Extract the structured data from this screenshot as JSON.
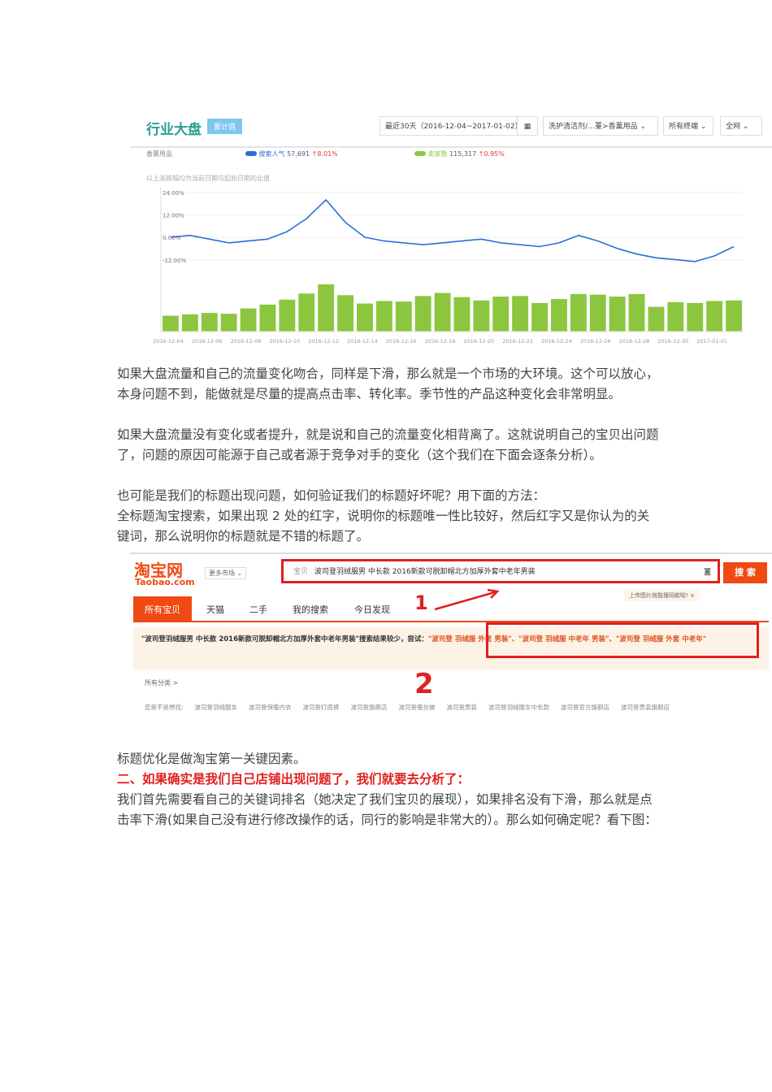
{
  "dashboard": {
    "title": "行业大盘",
    "badge": "累计值",
    "date_range": "最近30天（2016-12-04~2017-01-02）",
    "calendar_icon": "calendar-icon",
    "category": "洗护清洁剂/…薹>香薰用品",
    "terminal": "所有终端",
    "region": "全网",
    "category_label": "香薰用品",
    "note": "以上涨跌幅均为当前日期与起始日期的比值"
  },
  "chart_data": {
    "type": "bar+line",
    "title": "行业大盘",
    "x": [
      "2016-12-04",
      "2016-12-05",
      "2016-12-06",
      "2016-12-07",
      "2016-12-08",
      "2016-12-09",
      "2016-12-10",
      "2016-12-11",
      "2016-12-12",
      "2016-12-13",
      "2016-12-14",
      "2016-12-15",
      "2016-12-16",
      "2016-12-17",
      "2016-12-18",
      "2016-12-19",
      "2016-12-20",
      "2016-12-21",
      "2016-12-22",
      "2016-12-23",
      "2016-12-24",
      "2016-12-25",
      "2016-12-26",
      "2016-12-27",
      "2016-12-28",
      "2016-12-29",
      "2016-12-30",
      "2016-12-31",
      "2017-01-01",
      "2017-01-02"
    ],
    "tick_labels": [
      "2016-12-04",
      "2016-12-06",
      "2016-12-08",
      "2016-12-10",
      "2016-12-12",
      "2016-12-14",
      "2016-12-16",
      "2016-12-18",
      "2016-12-20",
      "2016-12-22",
      "2016-12-24",
      "2016-12-26",
      "2016-12-28",
      "2016-12-30",
      "2017-01-01"
    ],
    "yticks": [
      "24.00%",
      "12.00%",
      "0.00%",
      "-12.00%"
    ],
    "ylim": [
      -18,
      24
    ],
    "series": [
      {
        "name": "搜索人气",
        "value": "57,691",
        "change": "8.01%",
        "color": "#2b6fd6",
        "type": "line",
        "values": [
          0,
          1,
          -1,
          -3,
          -2,
          -1,
          3,
          10,
          20,
          8,
          0,
          -2,
          -3,
          -4,
          -3,
          -2,
          -1,
          -3,
          -4,
          -5,
          -3,
          1,
          -2,
          -6,
          -9,
          -11,
          -12,
          -13,
          -10,
          -5
        ]
      },
      {
        "name": "卖家数",
        "value": "115,317",
        "change": "0.95%",
        "color": "#8cc63f",
        "type": "bar",
        "values": [
          57,
          62,
          67,
          64,
          83,
          97,
          115,
          137,
          170,
          131,
          101,
          110,
          108,
          128,
          139,
          124,
          112,
          126,
          128,
          103,
          117,
          135,
          133,
          126,
          135,
          89,
          106,
          103,
          110,
          112
        ]
      }
    ]
  },
  "paragraphs": [
    "如果大盘流量和自己的流量变化吻合，同样是下滑，那么就是一个市场的大环境。这个可以放心，本身问题不到，能做就是尽量的提高点击率、转化率。季节性的产品这种变化会非常明显。",
    "如果大盘流量没有变化或者提升，就是说和自己的流量变化相背离了。这就说明自己的宝贝出问题了，问题的原因可能源于自己或者源于竞争对手的变化（这个我们在下面会逐条分析）。",
    "也可能是我们的标题出现问题，如何验证我们的标题好坏呢？用下面的方法：",
    "全标题淘宝搜索，如果出现 2 处的红字，说明你的标题唯一性比较好，然后红字又是你认为的关键词，那么说明你的标题就是不错的标题了。"
  ],
  "taobao": {
    "logo": "淘宝网",
    "logo_sub": "Taobao.com",
    "market": "更多市场",
    "scope": "宝贝",
    "query": "波司登羽绒服男 中长款 2016新款可脱卸帽北方加厚外套中老年男装",
    "search_button": "搜 索",
    "upload_tip": "上传图片就能搜同款啦!",
    "tabs": [
      "所有宝贝",
      "天猫",
      "二手",
      "我的搜索",
      "今日发现"
    ],
    "notice": "\"波司登羽绒服男 中长款 2016新款可脱卸帽北方加厚外套中老年男装\"搜索结果较少，尝试：",
    "suggestions": "\"波司登 羽绒服 外套 男装\"、\"波司登 羽绒服 中老年 男装\"、\"波司登 羽绒服 外套 中老年\"",
    "all_categories": "所有分类 >",
    "related_label": "您是不是想找:",
    "related": [
      "波司登羽绒服女",
      "波司登保暖内衣",
      "波司登打底裤",
      "波司登旗舰店",
      "波司登蚕丝被",
      "波司登男装",
      "波司登羽绒服女中长款",
      "波司登官方旗舰店",
      "波司登男装旗舰店"
    ],
    "marker1": "1",
    "marker2": "2"
  },
  "para_after": "标题优化是做淘宝第一关键因素。",
  "heading": "二、如果确实是我们自己店铺出现问题了，我们就要去分析了：",
  "para_last": "我们首先需要看自己的关键词排名（她决定了我们宝贝的展现），如果排名没有下滑，那么就是点击率下滑(如果自己没有进行修改操作的话，同行的影响是非常大的）。那么如何确定呢？看下图："
}
